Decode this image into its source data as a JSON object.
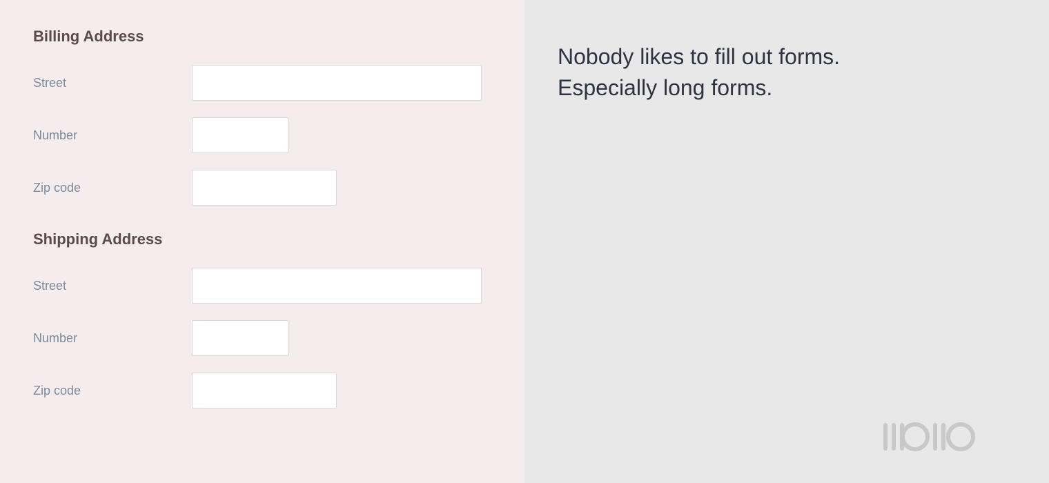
{
  "left": {
    "billing": {
      "title": "Billing Address",
      "fields": [
        {
          "label": "Street",
          "type": "street",
          "id": "billing-street"
        },
        {
          "label": "Number",
          "type": "number",
          "id": "billing-number"
        },
        {
          "label": "Zip code",
          "type": "zip",
          "id": "billing-zip"
        }
      ]
    },
    "shipping": {
      "title": "Shipping Address",
      "fields": [
        {
          "label": "Street",
          "type": "street",
          "id": "shipping-street"
        },
        {
          "label": "Number",
          "type": "number",
          "id": "shipping-number"
        },
        {
          "label": "Zip code",
          "type": "zip",
          "id": "shipping-zip"
        }
      ]
    }
  },
  "right": {
    "tagline_line1": "Nobody likes to fill out forms.",
    "tagline_line2": "Especially long forms.",
    "logo": "|||o||o"
  }
}
